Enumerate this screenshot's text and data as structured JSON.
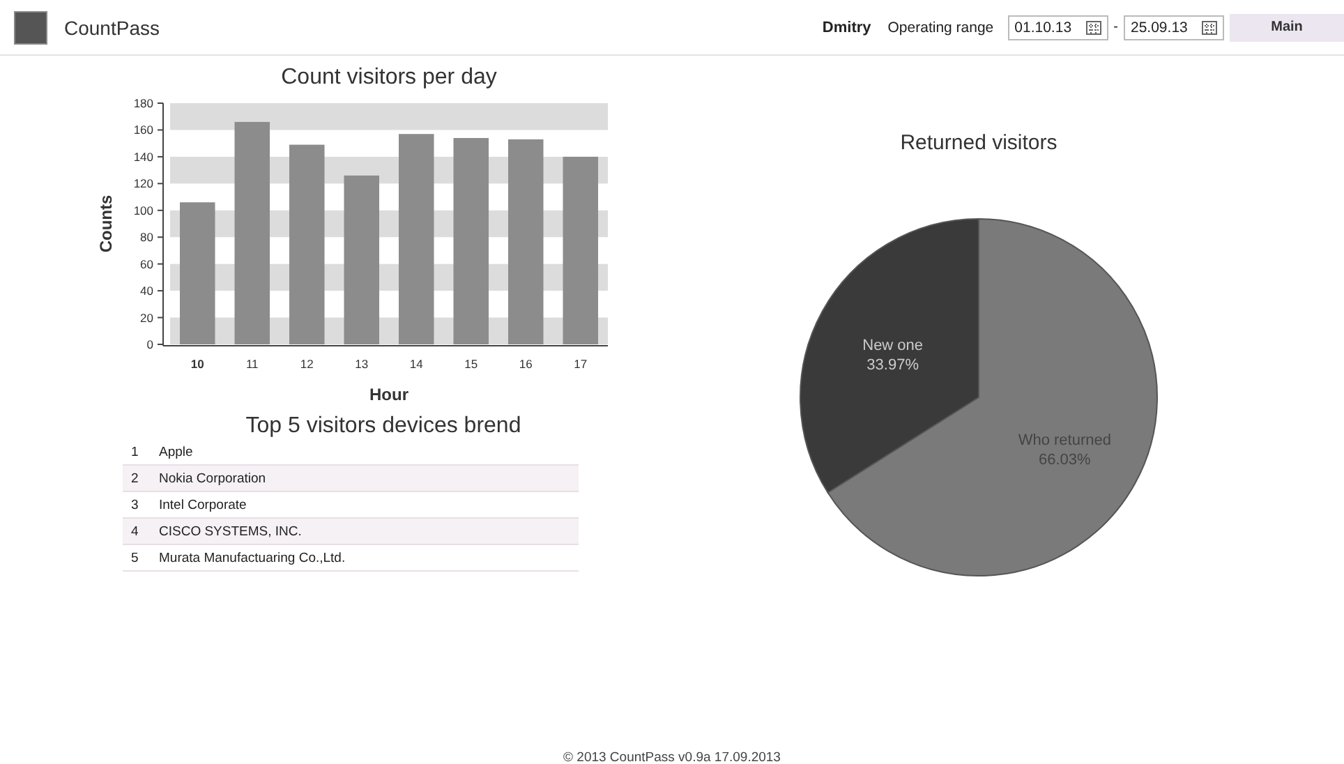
{
  "header": {
    "app_name": "CountPass",
    "user": "Dmitry",
    "range_label": "Operating range",
    "date_from": "01.10.13",
    "separator": "-",
    "date_to": "25.09.13",
    "menu_button": "Main"
  },
  "bar_chart": {
    "chart_data": {
      "type": "bar",
      "title": "Count visitors per day",
      "xlabel": "Hour",
      "ylabel": "Counts",
      "categories": [
        "10",
        "11",
        "12",
        "13",
        "14",
        "15",
        "16",
        "17"
      ],
      "series": [
        {
          "color": "#8c8c8c",
          "values": [
            106,
            166,
            149,
            126,
            157,
            154,
            153,
            140
          ]
        }
      ],
      "ylim": [
        0,
        180
      ],
      "yticks": [
        0,
        20,
        40,
        60,
        80,
        100,
        120,
        140,
        160,
        180
      ]
    }
  },
  "devices": {
    "title": "Top 5 visitors devices brend",
    "rows": [
      {
        "rank": "1",
        "name": "Apple"
      },
      {
        "rank": "2",
        "name": "Nokia Corporation"
      },
      {
        "rank": "3",
        "name": "Intel Corporate"
      },
      {
        "rank": "4",
        "name": "CISCO SYSTEMS, INC."
      },
      {
        "rank": "5",
        "name": "Murata Manufactuaring Co.,Ltd."
      }
    ]
  },
  "pie_chart": {
    "chart_data": {
      "type": "pie",
      "title": "Returned visitors",
      "categories": [
        "New one",
        "Who returned"
      ],
      "series": [
        {
          "values": [
            33.97,
            66.03
          ]
        }
      ],
      "value_labels": [
        "33.97%",
        "66.03%"
      ],
      "colors": [
        "#3a3a3a",
        "#7a7a7a"
      ]
    }
  },
  "footer": "© 2013 CountPass v0.9a 17.09.2013"
}
